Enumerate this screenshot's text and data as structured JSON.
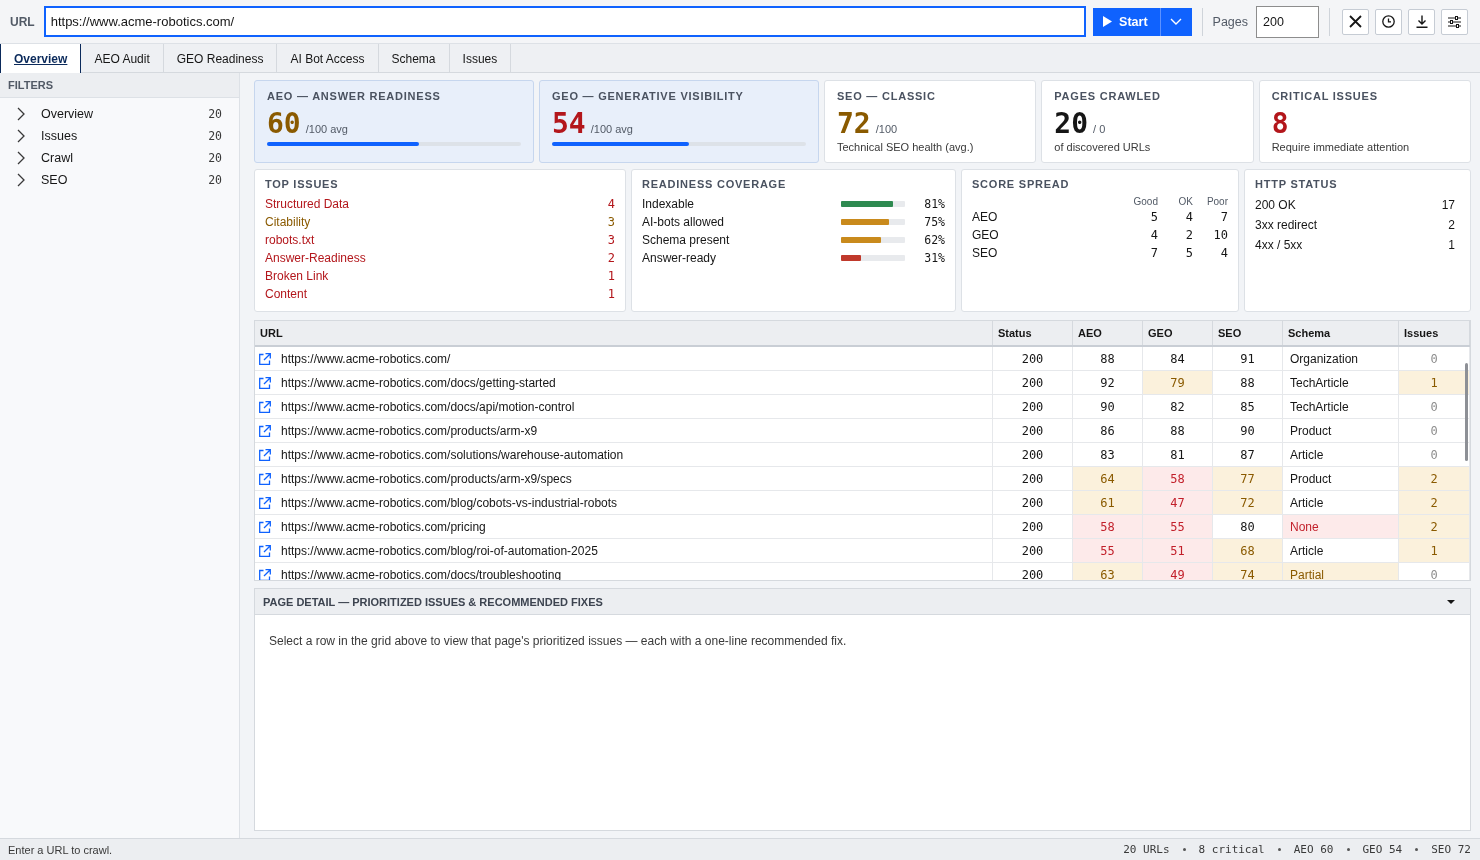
{
  "toolbar": {
    "url_label": "URL",
    "url_value": "https://www.acme-robotics.com/",
    "start_label": "Start",
    "pages_label": "Pages",
    "pages_value": "200"
  },
  "tabs": [
    {
      "label": "Overview",
      "selected": true
    },
    {
      "label": "AEO Audit",
      "selected": false
    },
    {
      "label": "GEO Readiness",
      "selected": false
    },
    {
      "label": "AI Bot Access",
      "selected": false
    },
    {
      "label": "Schema",
      "selected": false
    },
    {
      "label": "Issues",
      "selected": false
    }
  ],
  "sidebar": {
    "title": "FILTERS",
    "items": [
      {
        "label": "Overview",
        "count": "20",
        "expanded": false
      },
      {
        "label": "Issues",
        "count": "20",
        "expanded": false
      },
      {
        "label": "Crawl",
        "count": "20",
        "expanded": false
      },
      {
        "label": "SEO",
        "count": "20",
        "expanded": false
      }
    ]
  },
  "kpi_cards": [
    {
      "kind": "score",
      "title": "AEO — ANSWER READINESS",
      "value": "60",
      "unit": "/100 avg",
      "color": "#8a5a00",
      "level": 0.6
    },
    {
      "kind": "score",
      "title": "GEO — GENERATIVE VISIBILITY",
      "value": "54",
      "unit": "/100 avg",
      "color": "#b3161b",
      "level": 0.54
    },
    {
      "kind": "stat",
      "title": "SEO — CLASSIC",
      "value": "72",
      "unit": "/100",
      "note": "Technical SEO health (avg.)",
      "color": "#8a5a00"
    },
    {
      "kind": "stat",
      "title": "PAGES CRAWLED",
      "value": "20",
      "unit": "/ 0",
      "note": "of discovered URLs",
      "color": "#161616"
    },
    {
      "kind": "stat",
      "title": "CRITICAL ISSUES",
      "value": "8",
      "note": "Require immediate attention",
      "color": "#b3161b"
    }
  ],
  "top_issues": {
    "title": "TOP ISSUES",
    "items": [
      {
        "label": "Structured Data",
        "count": "4",
        "color": "#b3161b"
      },
      {
        "label": "Citability",
        "count": "3",
        "color": "#8a5a00"
      },
      {
        "label": "robots.txt",
        "count": "3",
        "color": "#b3161b"
      },
      {
        "label": "Answer-Readiness",
        "count": "2",
        "color": "#b3161b"
      },
      {
        "label": "Broken Link",
        "count": "1",
        "color": "#b3161b"
      },
      {
        "label": "Content",
        "count": "1",
        "color": "#b3161b"
      }
    ]
  },
  "readiness_coverage": {
    "title": "READINESS COVERAGE",
    "items": [
      {
        "label": "Indexable",
        "level": 0.81,
        "reading": "81%",
        "color": "#2e8a50"
      },
      {
        "label": "AI-bots allowed",
        "level": 0.75,
        "reading": "75%",
        "color": "#c98a1c"
      },
      {
        "label": "Schema present",
        "level": 0.62,
        "reading": "62%",
        "color": "#c98a1c"
      },
      {
        "label": "Answer-ready",
        "level": 0.31,
        "reading": "31%",
        "color": "#c0392b"
      }
    ]
  },
  "score_spread": {
    "title": "SCORE SPREAD",
    "columns": [
      "Good",
      "OK",
      "Poor"
    ],
    "rows": [
      {
        "label": "AEO",
        "values": [
          "5",
          "4",
          "7"
        ]
      },
      {
        "label": "GEO",
        "values": [
          "4",
          "2",
          "10"
        ]
      },
      {
        "label": "SEO",
        "values": [
          "7",
          "5",
          "4"
        ]
      }
    ]
  },
  "http_status": {
    "title": "HTTP STATUS",
    "rows": [
      {
        "label": "200 OK",
        "count": "17"
      },
      {
        "label": "3xx redirect",
        "count": "2"
      },
      {
        "label": "4xx / 5xx",
        "count": "1"
      }
    ]
  },
  "table": {
    "columns": [
      {
        "label": "URL",
        "kind": "url"
      },
      {
        "label": "Status",
        "kind": "number"
      },
      {
        "label": "AEO",
        "kind": "number"
      },
      {
        "label": "GEO",
        "kind": "number"
      },
      {
        "label": "SEO",
        "kind": "number"
      },
      {
        "label": "Schema",
        "kind": "text"
      },
      {
        "label": "Issues",
        "kind": "count"
      }
    ],
    "rows": [
      {
        "cells": [
          {
            "text": "https://www.acme-robotics.com/",
            "warning": false,
            "critical": false
          },
          {
            "text": "200",
            "warning": false,
            "critical": false
          },
          {
            "text": "88",
            "warning": false,
            "critical": false
          },
          {
            "text": "84",
            "warning": false,
            "critical": false
          },
          {
            "text": "91",
            "warning": false,
            "critical": false
          },
          {
            "text": "Organization",
            "warning": false,
            "critical": false
          },
          {
            "text": "0",
            "warning": false,
            "critical": false
          }
        ]
      },
      {
        "cells": [
          {
            "text": "https://www.acme-robotics.com/docs/getting-started",
            "warning": false,
            "critical": false
          },
          {
            "text": "200",
            "warning": false,
            "critical": false
          },
          {
            "text": "92",
            "warning": false,
            "critical": false
          },
          {
            "text": "79",
            "warning": true,
            "critical": false
          },
          {
            "text": "88",
            "warning": false,
            "critical": false
          },
          {
            "text": "TechArticle",
            "warning": false,
            "critical": false
          },
          {
            "text": "1",
            "warning": true,
            "critical": false
          }
        ]
      },
      {
        "cells": [
          {
            "text": "https://www.acme-robotics.com/docs/api/motion-control",
            "warning": false,
            "critical": false
          },
          {
            "text": "200",
            "warning": false,
            "critical": false
          },
          {
            "text": "90",
            "warning": false,
            "critical": false
          },
          {
            "text": "82",
            "warning": false,
            "critical": false
          },
          {
            "text": "85",
            "warning": false,
            "critical": false
          },
          {
            "text": "TechArticle",
            "warning": false,
            "critical": false
          },
          {
            "text": "0",
            "warning": false,
            "critical": false
          }
        ]
      },
      {
        "cells": [
          {
            "text": "https://www.acme-robotics.com/products/arm-x9",
            "warning": false,
            "critical": false
          },
          {
            "text": "200",
            "warning": false,
            "critical": false
          },
          {
            "text": "86",
            "warning": false,
            "critical": false
          },
          {
            "text": "88",
            "warning": false,
            "critical": false
          },
          {
            "text": "90",
            "warning": false,
            "critical": false
          },
          {
            "text": "Product",
            "warning": false,
            "critical": false
          },
          {
            "text": "0",
            "warning": false,
            "critical": false
          }
        ]
      },
      {
        "cells": [
          {
            "text": "https://www.acme-robotics.com/solutions/warehouse-automation",
            "warning": false,
            "critical": false
          },
          {
            "text": "200",
            "warning": false,
            "critical": false
          },
          {
            "text": "83",
            "warning": false,
            "critical": false
          },
          {
            "text": "81",
            "warning": false,
            "critical": false
          },
          {
            "text": "87",
            "warning": false,
            "critical": false
          },
          {
            "text": "Article",
            "warning": false,
            "critical": false
          },
          {
            "text": "0",
            "warning": false,
            "critical": false
          }
        ]
      },
      {
        "cells": [
          {
            "text": "https://www.acme-robotics.com/products/arm-x9/specs",
            "warning": false,
            "critical": false
          },
          {
            "text": "200",
            "warning": false,
            "critical": false
          },
          {
            "text": "64",
            "warning": true,
            "critical": false
          },
          {
            "text": "58",
            "warning": false,
            "critical": true
          },
          {
            "text": "77",
            "warning": true,
            "critical": false
          },
          {
            "text": "Product",
            "warning": false,
            "critical": false
          },
          {
            "text": "2",
            "warning": true,
            "critical": false
          }
        ]
      },
      {
        "cells": [
          {
            "text": "https://www.acme-robotics.com/blog/cobots-vs-industrial-robots",
            "warning": false,
            "critical": false
          },
          {
            "text": "200",
            "warning": false,
            "critical": false
          },
          {
            "text": "61",
            "warning": true,
            "critical": false
          },
          {
            "text": "47",
            "warning": false,
            "critical": true
          },
          {
            "text": "72",
            "warning": true,
            "critical": false
          },
          {
            "text": "Article",
            "warning": false,
            "critical": false
          },
          {
            "text": "2",
            "warning": true,
            "critical": false
          }
        ]
      },
      {
        "cells": [
          {
            "text": "https://www.acme-robotics.com/pricing",
            "warning": false,
            "critical": false
          },
          {
            "text": "200",
            "warning": false,
            "critical": false
          },
          {
            "text": "58",
            "warning": false,
            "critical": true
          },
          {
            "text": "55",
            "warning": false,
            "critical": true
          },
          {
            "text": "80",
            "warning": false,
            "critical": false
          },
          {
            "text": "None",
            "warning": false,
            "critical": true
          },
          {
            "text": "2",
            "warning": true,
            "critical": false
          }
        ]
      },
      {
        "cells": [
          {
            "text": "https://www.acme-robotics.com/blog/roi-of-automation-2025",
            "warning": false,
            "critical": false
          },
          {
            "text": "200",
            "warning": false,
            "critical": false
          },
          {
            "text": "55",
            "warning": false,
            "critical": true
          },
          {
            "text": "51",
            "warning": false,
            "critical": true
          },
          {
            "text": "68",
            "warning": true,
            "critical": false
          },
          {
            "text": "Article",
            "warning": false,
            "critical": false
          },
          {
            "text": "1",
            "warning": true,
            "critical": false
          }
        ]
      },
      {
        "cells": [
          {
            "text": "https://www.acme-robotics.com/docs/troubleshooting",
            "warning": false,
            "critical": false
          },
          {
            "text": "200",
            "warning": false,
            "critical": false
          },
          {
            "text": "63",
            "warning": true,
            "critical": false
          },
          {
            "text": "49",
            "warning": false,
            "critical": true
          },
          {
            "text": "74",
            "warning": true,
            "critical": false
          },
          {
            "text": "Partial",
            "warning": true,
            "critical": false
          },
          {
            "text": "0",
            "warning": false,
            "critical": false
          }
        ]
      }
    ]
  },
  "page_detail": {
    "title": "PAGE DETAIL — PRIORITIZED ISSUES & RECOMMENDED FIXES",
    "expanded": true,
    "message": "Select a row in the grid above to view that page's prioritized issues — each with a one-line recommended fix."
  },
  "status_bar": {
    "message": "Enter a URL to crawl.",
    "stats": [
      "20 URLs",
      "8 critical",
      "AEO 60",
      "GEO 54",
      "SEO 72"
    ]
  }
}
